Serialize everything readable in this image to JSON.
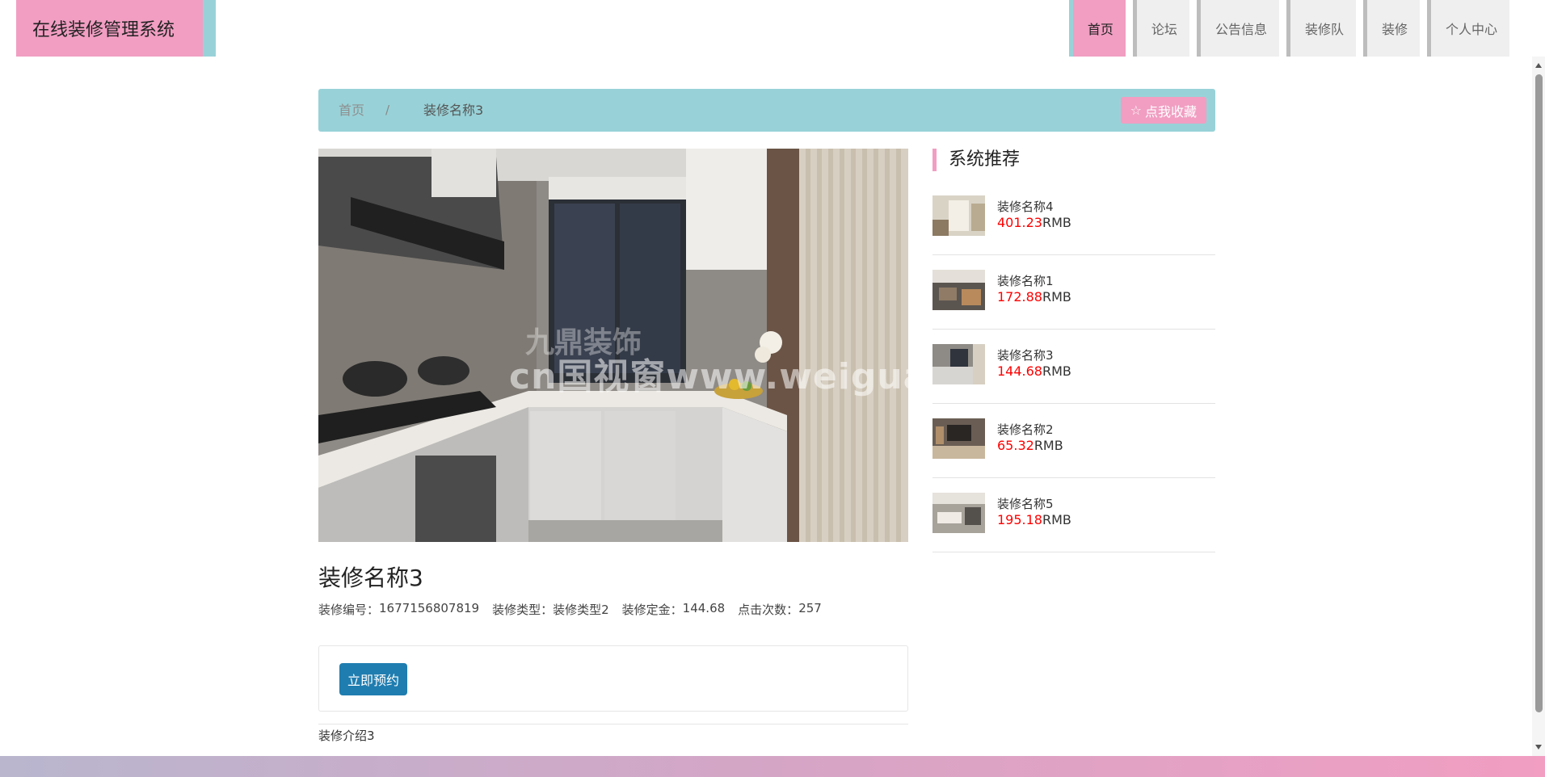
{
  "header": {
    "logo": "在线装修管理系统",
    "nav": [
      {
        "label": "首页",
        "active": true
      },
      {
        "label": "论坛",
        "active": false
      },
      {
        "label": "公告信息",
        "active": false
      },
      {
        "label": "装修队",
        "active": false
      },
      {
        "label": "装修",
        "active": false
      },
      {
        "label": "个人中心",
        "active": false
      }
    ]
  },
  "breadcrumb": {
    "home": "首页",
    "separator": "/",
    "current": "装修名称3",
    "favorite_label": "点我收藏",
    "favorite_icon": "star-outline-icon"
  },
  "detail": {
    "title": "装修名称3",
    "meta": [
      {
        "label": "装修编号：",
        "value": "1677156807819"
      },
      {
        "label": "装修类型：",
        "value": "装修类型2"
      },
      {
        "label": "装修定金：",
        "value": "144.68"
      },
      {
        "label": "点击次数：",
        "value": "257"
      }
    ],
    "book_label": "立即预约",
    "intro": "装修介绍3"
  },
  "recommend": {
    "title": "系统推荐",
    "currency": "RMB",
    "items": [
      {
        "name": "装修名称4",
        "price": "401.23"
      },
      {
        "name": "装修名称1",
        "price": "172.88"
      },
      {
        "name": "装修名称3",
        "price": "144.68"
      },
      {
        "name": "装修名称2",
        "price": "65.32"
      },
      {
        "name": "装修名称5",
        "price": "195.18"
      }
    ]
  },
  "watermark": "cn国视窗www.weiguanme.cn",
  "colors": {
    "accent_pink": "#f19ec2",
    "accent_teal": "#98d2d8",
    "button_blue": "#1f7db0",
    "price_red": "#ff0000"
  }
}
